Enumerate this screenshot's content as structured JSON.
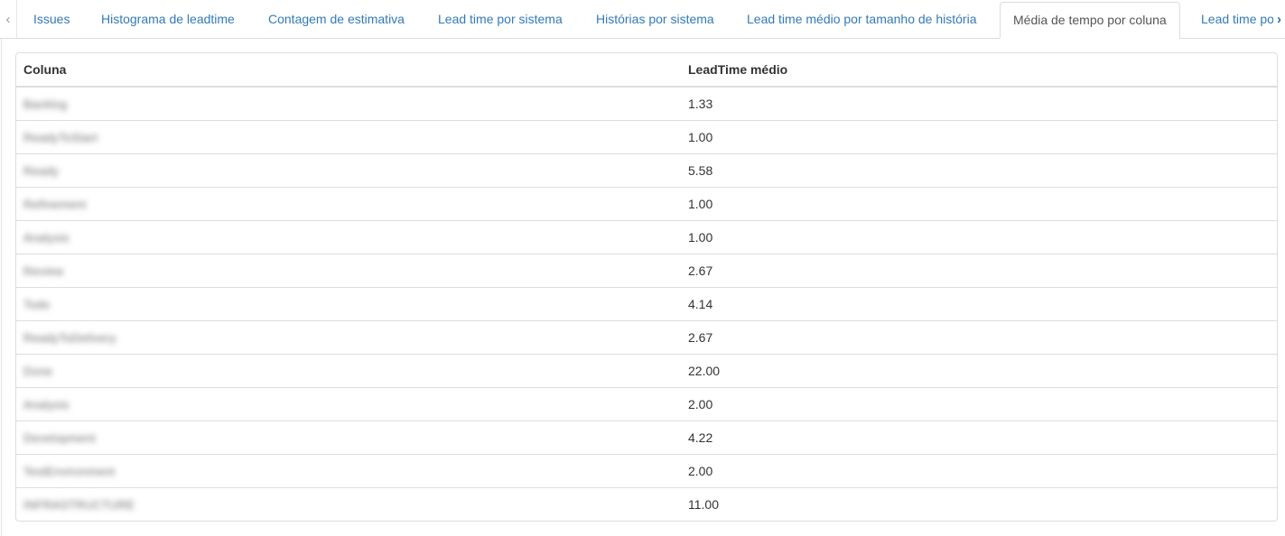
{
  "tabs": [
    {
      "label": "Issues",
      "active": false
    },
    {
      "label": "Histograma de leadtime",
      "active": false
    },
    {
      "label": "Contagem de estimativa",
      "active": false
    },
    {
      "label": "Lead time por sistema",
      "active": false
    },
    {
      "label": "Histórias por sistema",
      "active": false
    },
    {
      "label": "Lead time médio por tamanho de história",
      "active": false
    },
    {
      "label": "Média de tempo por coluna",
      "active": true
    },
    {
      "label": "Lead time po",
      "active": false
    }
  ],
  "icons": {
    "scroll_left": "chevron-left-icon",
    "scroll_right": "chevron-right-icon"
  },
  "table": {
    "headers": [
      "Coluna",
      "LeadTime médio"
    ],
    "rows": [
      {
        "coluna": "Backlog",
        "leadtime": "1.33"
      },
      {
        "coluna": "ReadyToStart",
        "leadtime": "1.00"
      },
      {
        "coluna": "Ready",
        "leadtime": "5.58"
      },
      {
        "coluna": "Refinement",
        "leadtime": "1.00"
      },
      {
        "coluna": "Analysis",
        "leadtime": "1.00"
      },
      {
        "coluna": "Review",
        "leadtime": "2.67"
      },
      {
        "coluna": "Todo",
        "leadtime": "4.14"
      },
      {
        "coluna": "ReadyToDelivery",
        "leadtime": "2.67"
      },
      {
        "coluna": "Done",
        "leadtime": "22.00"
      },
      {
        "coluna": "Analysis",
        "leadtime": "2.00"
      },
      {
        "coluna": "Development",
        "leadtime": "4.22"
      },
      {
        "coluna": "TestEnvironment",
        "leadtime": "2.00"
      },
      {
        "coluna": "INFRASTRUCTURE",
        "leadtime": "11.00"
      }
    ]
  },
  "colors": {
    "link": "#337ab7",
    "active_tab_text": "#555555",
    "border": "#dddddd"
  }
}
